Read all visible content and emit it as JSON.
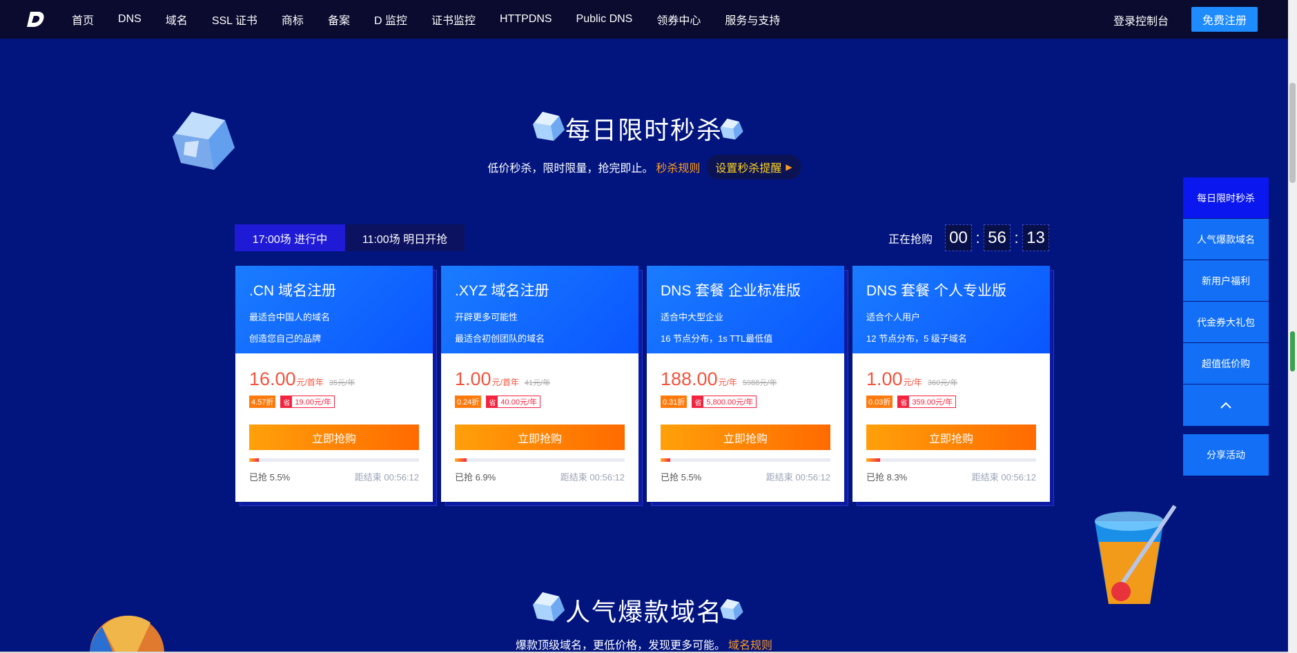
{
  "nav": {
    "items": [
      "首页",
      "DNS",
      "域名",
      "SSL 证书",
      "商标",
      "备案",
      "D 监控",
      "证书监控",
      "HTTPDNS",
      "Public DNS",
      "领券中心",
      "服务与支持"
    ],
    "login": "登录控制台",
    "register": "免费注册"
  },
  "flash": {
    "title": "每日限时秒杀",
    "subtitle": "低价秒杀，限时限量，抢完即止。",
    "rule_link": "秒杀规则",
    "reminder": "设置秒杀提醒"
  },
  "sessions": {
    "active": "17:00场 进行中",
    "next": "11:00场 明日开抢"
  },
  "countdown": {
    "label": "正在抢购",
    "hours": "00",
    "minutes": "56",
    "seconds": "13"
  },
  "cards": [
    {
      "title": ".CN 域名注册",
      "line1": "最适合中国人的域名",
      "line2": "创造您自己的品牌",
      "price": "16.00",
      "unit": "元/首年",
      "old": "35元/年",
      "discount": "4.57折",
      "save": "19.00元/年",
      "buy": "立即抢购",
      "progress": 5.5,
      "sold": "已抢 5.5%",
      "remain": "距结束 00:56:12"
    },
    {
      "title": ".XYZ 域名注册",
      "line1": "开辟更多可能性",
      "line2": "最适合初创团队的域名",
      "price": "1.00",
      "unit": "元/首年",
      "old": "41元/年",
      "discount": "0.24折",
      "save": "40.00元/年",
      "buy": "立即抢购",
      "progress": 6.9,
      "sold": "已抢 6.9%",
      "remain": "距结束 00:56:12"
    },
    {
      "title": "DNS 套餐 企业标准版",
      "line1": "适合中大型企业",
      "line2": "16 节点分布，1s TTL最低值",
      "price": "188.00",
      "unit": "元/年",
      "old": "5988元/年",
      "discount": "0.31折",
      "save": "5,800.00元/年",
      "buy": "立即抢购",
      "progress": 5.5,
      "sold": "已抢 5.5%",
      "remain": "距结束 00:56:12"
    },
    {
      "title": "DNS 套餐 个人专业版",
      "line1": "适合个人用户",
      "line2": "12 节点分布，5 级子域名",
      "price": "1.00",
      "unit": "元/年",
      "old": "360元/年",
      "discount": "0.03折",
      "save": "359.00元/年",
      "buy": "立即抢购",
      "progress": 8.3,
      "sold": "已抢 8.3%",
      "remain": "距结束 00:56:12"
    }
  ],
  "save_icon": "省",
  "side_nav": {
    "items": [
      "每日限时秒杀",
      "人气爆款域名",
      "新用户福利",
      "代金券大礼包",
      "超值低价购"
    ],
    "share": "分享活动"
  },
  "hot": {
    "title": "人气爆款域名",
    "subtitle": "爆款顶级域名，更低价格，发现更多可能。",
    "rule_link": "域名规则"
  },
  "colors": {
    "page_bg": "#02157f",
    "nav_bg": "#0a0b2e",
    "accent_blue": "#1e8bff",
    "price_red": "#f4533d",
    "orange": "#ff7a0d"
  }
}
